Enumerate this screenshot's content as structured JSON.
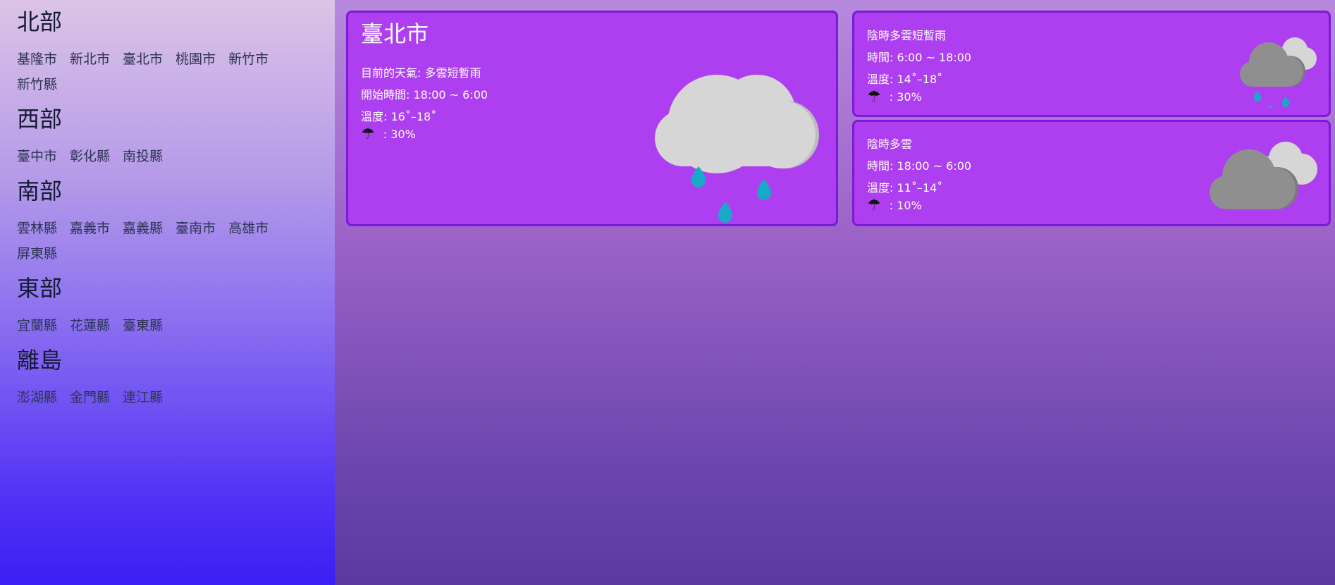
{
  "regions": [
    {
      "title": "北部",
      "cities": [
        "基隆市",
        "新北市",
        "臺北市",
        "桃園市",
        "新竹市",
        "新竹縣"
      ]
    },
    {
      "title": "西部",
      "cities": [
        "臺中市",
        "彰化縣",
        "南投縣"
      ]
    },
    {
      "title": "南部",
      "cities": [
        "雲林縣",
        "嘉義市",
        "嘉義縣",
        "臺南市",
        "高雄市",
        "屏東縣"
      ]
    },
    {
      "title": "東部",
      "cities": [
        "宜蘭縣",
        "花蓮縣",
        "臺東縣"
      ]
    },
    {
      "title": "離島",
      "cities": [
        "澎湖縣",
        "金門縣",
        "連江縣"
      ]
    }
  ],
  "current": {
    "city": "臺北市",
    "weather_line": "目前的天氣: 多雲短暫雨",
    "start_line": "開始時間: 18:00 ~ 6:00",
    "temp_line": "溫度: 16˚–18˚",
    "umbrella_icon": "☂",
    "rain_line": ": 30%",
    "icon": "cloud-rain-icon"
  },
  "forecasts": [
    {
      "desc": "陰時多雲短暫雨",
      "time_line": "時間: 6:00 ~ 18:00",
      "temp_line": "溫度: 14˚–18˚",
      "umbrella_icon": "☂",
      "rain_line": ": 30%",
      "icon": "cloud-rain-icon"
    },
    {
      "desc": "陰時多雲",
      "time_line": "時間: 18:00 ~ 6:00",
      "temp_line": "溫度: 11˚–14˚",
      "umbrella_icon": "☂",
      "rain_line": ": 10%",
      "icon": "cloudy-icon"
    }
  ],
  "colors": {
    "card_bg": "#ad3ff0",
    "card_border": "#7d1ad6",
    "rain_drop": "#18a9c9",
    "cloud_light": "#d6d6d6",
    "cloud_dark": "#8f8f8f"
  }
}
